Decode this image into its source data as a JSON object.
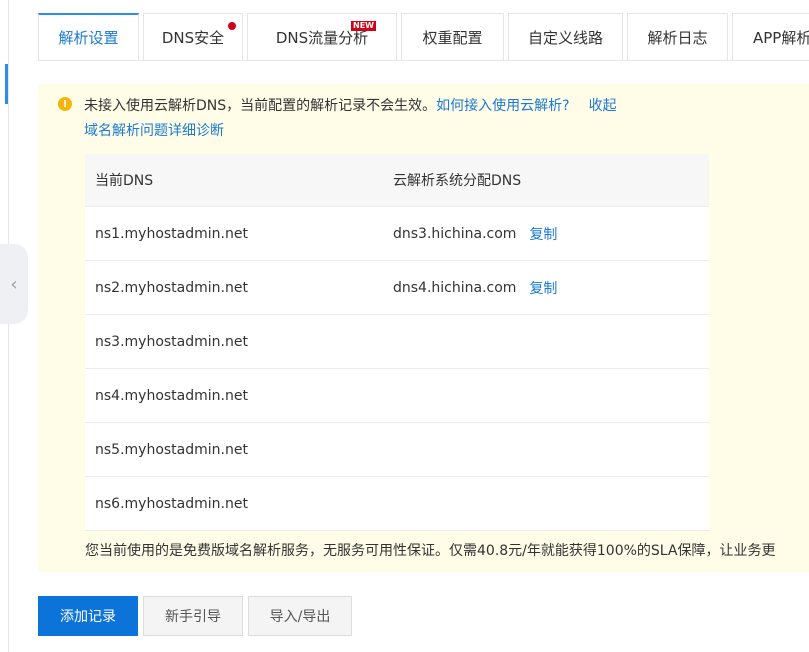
{
  "tabs": [
    {
      "label": "解析设置"
    },
    {
      "label": "DNS安全"
    },
    {
      "label": "DNS流量分析",
      "badge": "NEW"
    },
    {
      "label": "权重配置"
    },
    {
      "label": "自定义线路"
    },
    {
      "label": "解析日志"
    },
    {
      "label": "APP解析"
    }
  ],
  "notice": {
    "text": "未接入使用云解析DNS，当前配置的解析记录不会生效。",
    "how_link": "如何接入使用云解析?",
    "collapse": "收起",
    "diagnose_link": "域名解析问题详细诊断"
  },
  "table": {
    "headers": [
      "当前DNS",
      "云解析系统分配DNS"
    ],
    "copy_label": "复制",
    "rows": [
      {
        "current": "ns1.myhostadmin.net",
        "assigned": "dns3.hichina.com"
      },
      {
        "current": "ns2.myhostadmin.net",
        "assigned": "dns4.hichina.com"
      },
      {
        "current": "ns3.myhostadmin.net",
        "assigned": ""
      },
      {
        "current": "ns4.myhostadmin.net",
        "assigned": ""
      },
      {
        "current": "ns5.myhostadmin.net",
        "assigned": ""
      },
      {
        "current": "ns6.myhostadmin.net",
        "assigned": ""
      }
    ]
  },
  "footer_text": "您当前使用的是免费版域名解析服务，无服务可用性保证。仅需40.8元/年就能获得100%的SLA保障，让业务更",
  "buttons": {
    "add": "添加记录",
    "guide": "新手引导",
    "import_export": "导入/导出"
  },
  "colors": {
    "accent": "#1a7ad4",
    "notice_bg": "#fffde8",
    "primary_button": "#0c73d9",
    "badge": "#d0021b"
  },
  "icons": {
    "warning": "warning-icon",
    "collapse": "chevron-left-icon"
  }
}
